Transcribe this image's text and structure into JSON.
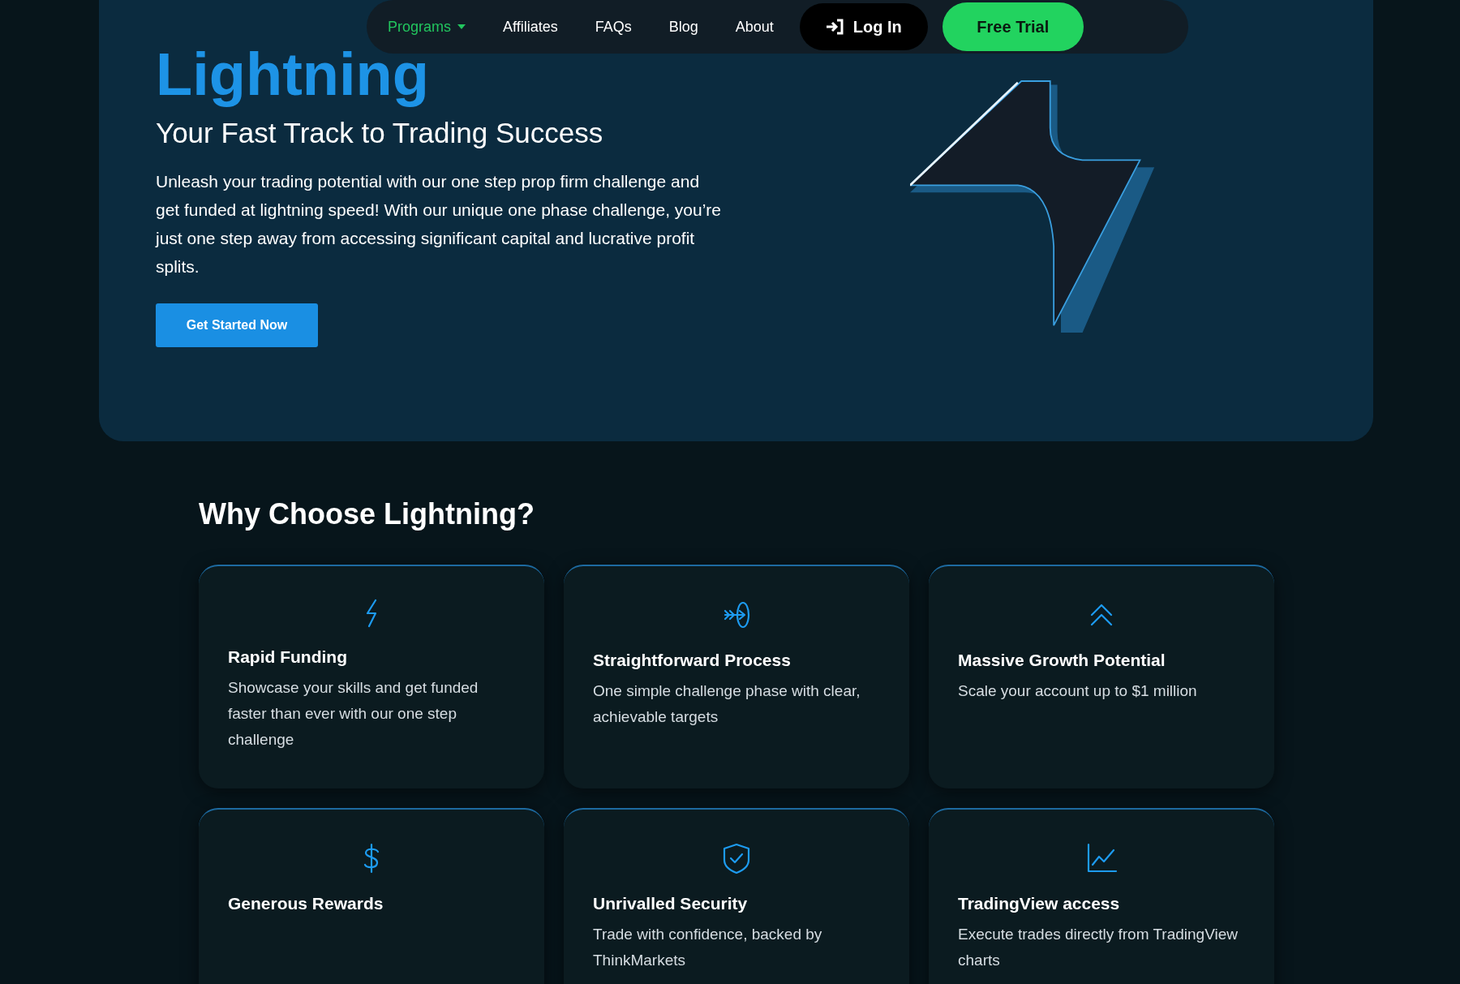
{
  "nav": {
    "items": [
      {
        "label": "Programs",
        "selected": true,
        "dropdown": true
      },
      {
        "label": "Affiliates",
        "selected": false,
        "dropdown": false
      },
      {
        "label": "FAQs",
        "selected": false,
        "dropdown": false
      },
      {
        "label": "Blog",
        "selected": false,
        "dropdown": false
      },
      {
        "label": "About",
        "selected": false,
        "dropdown": false
      }
    ],
    "login": "Log In",
    "trial": "Free Trial"
  },
  "hero": {
    "title": "Lightning",
    "subtitle": "Your Fast Track to Trading Success",
    "description": "Unleash your trading potential with our one step prop firm challenge and get funded at lightning speed! With our unique one phase challenge, you’re just one step away from accessing significant capital and lucrative profit splits.",
    "cta": "Get Started Now"
  },
  "features": {
    "heading": "Why Choose Lightning?",
    "cards": [
      {
        "title": "Rapid Funding",
        "text": "Showcase your skills and get funded faster than ever with our one step challenge"
      },
      {
        "title": "Straightforward Process",
        "text": "One simple challenge phase with clear, achievable targets"
      },
      {
        "title": "Massive Growth Potential",
        "text": "Scale your account up to $1 million"
      },
      {
        "title": "Generous Rewards"
      },
      {
        "title": "Unrivalled Security",
        "text": "Trade with confidence, backed by ThinkMarkets"
      },
      {
        "title": "TradingView access",
        "text": "Execute trades directly from TradingView charts"
      }
    ]
  }
}
